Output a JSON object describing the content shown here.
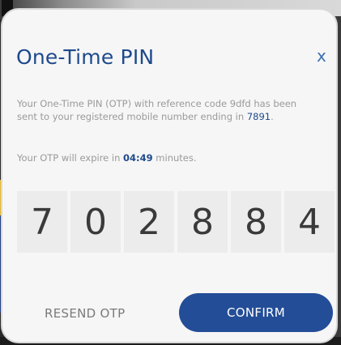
{
  "modal": {
    "title": "One-Time PIN",
    "close_label": "x",
    "desc_prefix": "Your One-Time PIN (OTP) with reference code 9dfd has been sent to your registered mobile number ending in ",
    "mobile_last4": "7891",
    "desc_suffix": ".",
    "expire_prefix": "Your OTP will expire in ",
    "expire_time": "04:49",
    "expire_suffix": " minutes.",
    "otp_digits": [
      "7",
      "0",
      "2",
      "8",
      "8",
      "4"
    ],
    "resend_label": "RESEND OTP",
    "confirm_label": "CONFIRM"
  },
  "colors": {
    "accent": "#1e4a8c",
    "button_bg": "#234d97",
    "muted_text": "#9a9a9a",
    "modal_bg": "#f6f6f6",
    "digit_box_bg": "#ececec"
  }
}
